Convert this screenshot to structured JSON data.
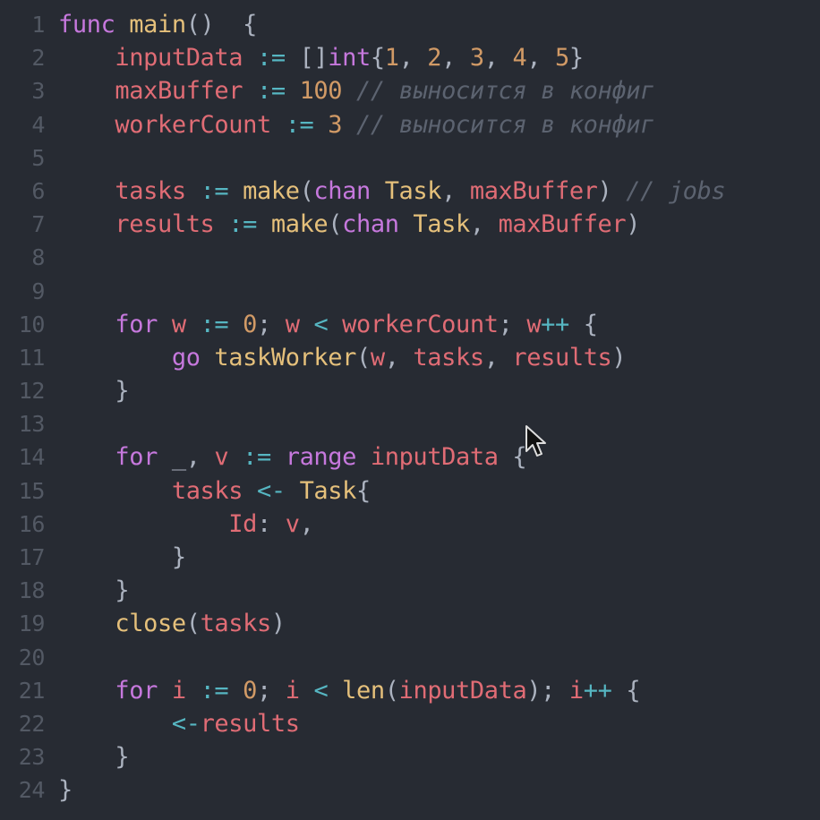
{
  "editor": {
    "language": "go",
    "theme_colors": {
      "background": "#272b33",
      "line_number": "#535964",
      "keyword": "#c678dd",
      "function": "#e5c07b",
      "variable": "#e06c75",
      "type": "#e5c07b",
      "number": "#d19a66",
      "operator": "#56b6c2",
      "punctuation": "#abb2bf",
      "comment": "#5c6370"
    },
    "lines": [
      {
        "n": "1",
        "tokens": [
          [
            "kw",
            "func"
          ],
          [
            "p",
            " "
          ],
          [
            "fn",
            "main"
          ],
          [
            "p",
            "()  {"
          ]
        ]
      },
      {
        "n": "2",
        "tokens": [
          [
            "p",
            "    "
          ],
          [
            "v",
            "inputData"
          ],
          [
            "p",
            " "
          ],
          [
            "op",
            ":="
          ],
          [
            "p",
            " []"
          ],
          [
            "kw",
            "int"
          ],
          [
            "p",
            "{"
          ],
          [
            "num",
            "1"
          ],
          [
            "p",
            ", "
          ],
          [
            "num",
            "2"
          ],
          [
            "p",
            ", "
          ],
          [
            "num",
            "3"
          ],
          [
            "p",
            ", "
          ],
          [
            "num",
            "4"
          ],
          [
            "p",
            ", "
          ],
          [
            "num",
            "5"
          ],
          [
            "p",
            "}"
          ]
        ]
      },
      {
        "n": "3",
        "tokens": [
          [
            "p",
            "    "
          ],
          [
            "v",
            "maxBuffer"
          ],
          [
            "p",
            " "
          ],
          [
            "op",
            ":="
          ],
          [
            "p",
            " "
          ],
          [
            "num",
            "100"
          ],
          [
            "p",
            " "
          ],
          [
            "cm",
            "// выносится в конфиг"
          ]
        ]
      },
      {
        "n": "4",
        "tokens": [
          [
            "p",
            "    "
          ],
          [
            "v",
            "workerCount"
          ],
          [
            "p",
            " "
          ],
          [
            "op",
            ":="
          ],
          [
            "p",
            " "
          ],
          [
            "num",
            "3"
          ],
          [
            "p",
            " "
          ],
          [
            "cm",
            "// выносится в конфиг"
          ]
        ]
      },
      {
        "n": "5",
        "tokens": []
      },
      {
        "n": "6",
        "tokens": [
          [
            "p",
            "    "
          ],
          [
            "v",
            "tasks"
          ],
          [
            "p",
            " "
          ],
          [
            "op",
            ":="
          ],
          [
            "p",
            " "
          ],
          [
            "fn",
            "make"
          ],
          [
            "p",
            "("
          ],
          [
            "kw",
            "chan"
          ],
          [
            "p",
            " "
          ],
          [
            "t",
            "Task"
          ],
          [
            "p",
            ", "
          ],
          [
            "v",
            "maxBuffer"
          ],
          [
            "p",
            ") "
          ],
          [
            "cm",
            "// jobs"
          ]
        ]
      },
      {
        "n": "7",
        "tokens": [
          [
            "p",
            "    "
          ],
          [
            "v",
            "results"
          ],
          [
            "p",
            " "
          ],
          [
            "op",
            ":="
          ],
          [
            "p",
            " "
          ],
          [
            "fn",
            "make"
          ],
          [
            "p",
            "("
          ],
          [
            "kw",
            "chan"
          ],
          [
            "p",
            " "
          ],
          [
            "t",
            "Task"
          ],
          [
            "p",
            ", "
          ],
          [
            "v",
            "maxBuffer"
          ],
          [
            "p",
            ")"
          ]
        ]
      },
      {
        "n": "8",
        "tokens": []
      },
      {
        "n": "9",
        "tokens": []
      },
      {
        "n": "10",
        "tokens": [
          [
            "p",
            "    "
          ],
          [
            "kw",
            "for"
          ],
          [
            "p",
            " "
          ],
          [
            "v",
            "w"
          ],
          [
            "p",
            " "
          ],
          [
            "op",
            ":="
          ],
          [
            "p",
            " "
          ],
          [
            "num",
            "0"
          ],
          [
            "p",
            "; "
          ],
          [
            "v",
            "w"
          ],
          [
            "p",
            " "
          ],
          [
            "op",
            "<"
          ],
          [
            "p",
            " "
          ],
          [
            "v",
            "workerCount"
          ],
          [
            "p",
            "; "
          ],
          [
            "v",
            "w"
          ],
          [
            "op",
            "++"
          ],
          [
            "p",
            " {"
          ]
        ]
      },
      {
        "n": "11",
        "tokens": [
          [
            "p",
            "        "
          ],
          [
            "kw",
            "go"
          ],
          [
            "p",
            " "
          ],
          [
            "fn",
            "taskWorker"
          ],
          [
            "p",
            "("
          ],
          [
            "v",
            "w"
          ],
          [
            "p",
            ", "
          ],
          [
            "v",
            "tasks"
          ],
          [
            "p",
            ", "
          ],
          [
            "v",
            "results"
          ],
          [
            "p",
            ")"
          ]
        ]
      },
      {
        "n": "12",
        "tokens": [
          [
            "p",
            "    }"
          ]
        ]
      },
      {
        "n": "13",
        "tokens": []
      },
      {
        "n": "14",
        "tokens": [
          [
            "p",
            "    "
          ],
          [
            "kw",
            "for"
          ],
          [
            "p",
            " _, "
          ],
          [
            "v",
            "v"
          ],
          [
            "p",
            " "
          ],
          [
            "op",
            ":="
          ],
          [
            "p",
            " "
          ],
          [
            "kw",
            "range"
          ],
          [
            "p",
            " "
          ],
          [
            "v",
            "inputData"
          ],
          [
            "p",
            " {"
          ]
        ]
      },
      {
        "n": "15",
        "tokens": [
          [
            "p",
            "        "
          ],
          [
            "v",
            "tasks"
          ],
          [
            "p",
            " "
          ],
          [
            "op",
            "<-"
          ],
          [
            "p",
            " "
          ],
          [
            "t",
            "Task"
          ],
          [
            "p",
            "{"
          ]
        ]
      },
      {
        "n": "16",
        "tokens": [
          [
            "p",
            "            "
          ],
          [
            "v",
            "Id"
          ],
          [
            "p",
            ": "
          ],
          [
            "v",
            "v"
          ],
          [
            "p",
            ","
          ]
        ]
      },
      {
        "n": "17",
        "tokens": [
          [
            "p",
            "        }"
          ]
        ]
      },
      {
        "n": "18",
        "tokens": [
          [
            "p",
            "    }"
          ]
        ]
      },
      {
        "n": "19",
        "tokens": [
          [
            "p",
            "    "
          ],
          [
            "fn",
            "close"
          ],
          [
            "p",
            "("
          ],
          [
            "v",
            "tasks"
          ],
          [
            "p",
            ")"
          ]
        ]
      },
      {
        "n": "20",
        "tokens": []
      },
      {
        "n": "21",
        "tokens": [
          [
            "p",
            "    "
          ],
          [
            "kw",
            "for"
          ],
          [
            "p",
            " "
          ],
          [
            "v",
            "i"
          ],
          [
            "p",
            " "
          ],
          [
            "op",
            ":="
          ],
          [
            "p",
            " "
          ],
          [
            "num",
            "0"
          ],
          [
            "p",
            "; "
          ],
          [
            "v",
            "i"
          ],
          [
            "p",
            " "
          ],
          [
            "op",
            "<"
          ],
          [
            "p",
            " "
          ],
          [
            "fn",
            "len"
          ],
          [
            "p",
            "("
          ],
          [
            "v",
            "inputData"
          ],
          [
            "p",
            "); "
          ],
          [
            "v",
            "i"
          ],
          [
            "op",
            "++"
          ],
          [
            "p",
            " {"
          ]
        ]
      },
      {
        "n": "22",
        "tokens": [
          [
            "p",
            "        "
          ],
          [
            "op",
            "<-"
          ],
          [
            "v",
            "results"
          ]
        ]
      },
      {
        "n": "23",
        "tokens": [
          [
            "p",
            "    }"
          ]
        ]
      },
      {
        "n": "24",
        "tokens": [
          [
            "p",
            "}"
          ]
        ]
      }
    ]
  },
  "cursor": {
    "icon": "mouse-pointer-icon"
  }
}
